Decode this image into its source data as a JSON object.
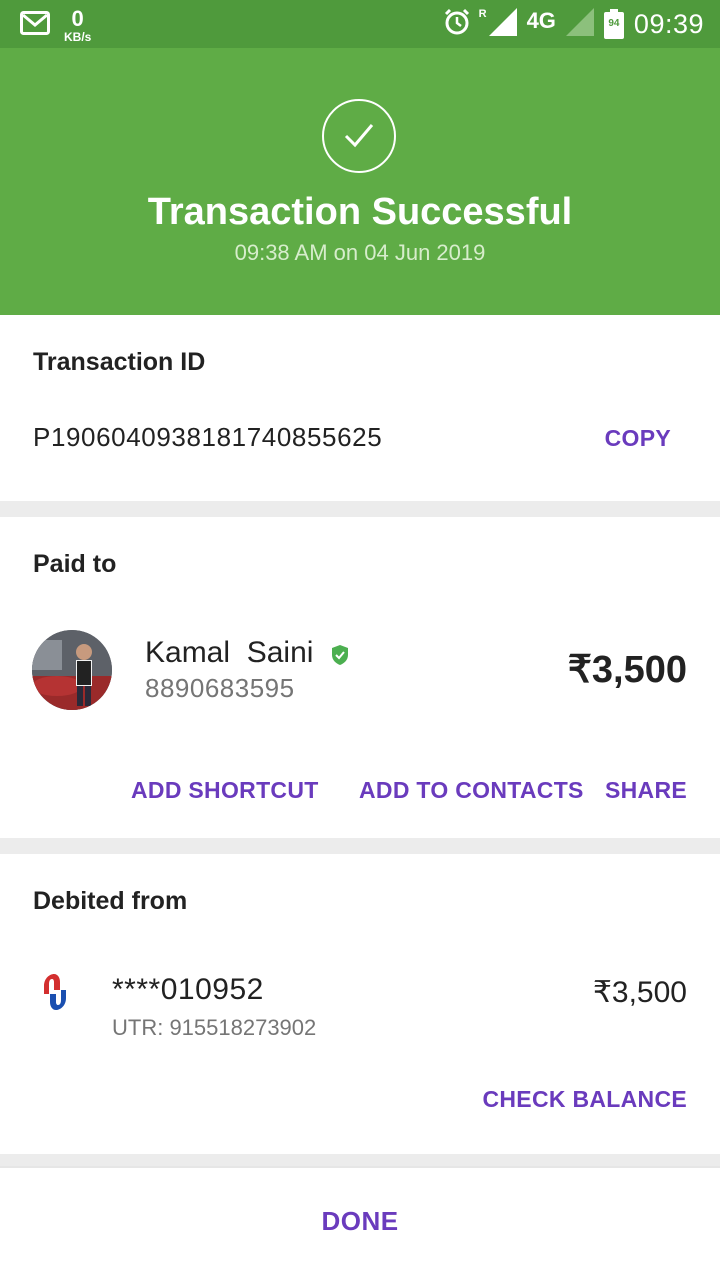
{
  "status_bar": {
    "net_speed_value": "0",
    "net_speed_unit": "KB/s",
    "roaming": "R",
    "network": "4G",
    "battery_level": "94",
    "time": "09:39",
    "icons": [
      "gmail-icon",
      "alarm-icon",
      "signal-icon",
      "battery-icon"
    ]
  },
  "header": {
    "title": "Transaction Successful",
    "datetime": "09:38 AM on 04 Jun 2019",
    "color": "#5fac46"
  },
  "transaction": {
    "label": "Transaction ID",
    "id": "P1906040938181740855625",
    "copy_label": "COPY"
  },
  "paid_to": {
    "label": "Paid to",
    "name": "Kamal  Saini",
    "phone": "8890683595",
    "amount": "₹3,500",
    "actions": {
      "add_shortcut": "ADD SHORTCUT",
      "add_to_contacts": "ADD TO CONTACTS",
      "share": "SHARE"
    }
  },
  "debited_from": {
    "label": "Debited from",
    "account": "****010952",
    "utr": "UTR: 915518273902",
    "amount": "₹3,500",
    "check_balance": "CHECK BALANCE"
  },
  "footer": {
    "done_label": "DONE"
  },
  "colors": {
    "accent": "#6a3bbd",
    "success": "#5fac46",
    "status_bar": "#4f9a3c"
  }
}
